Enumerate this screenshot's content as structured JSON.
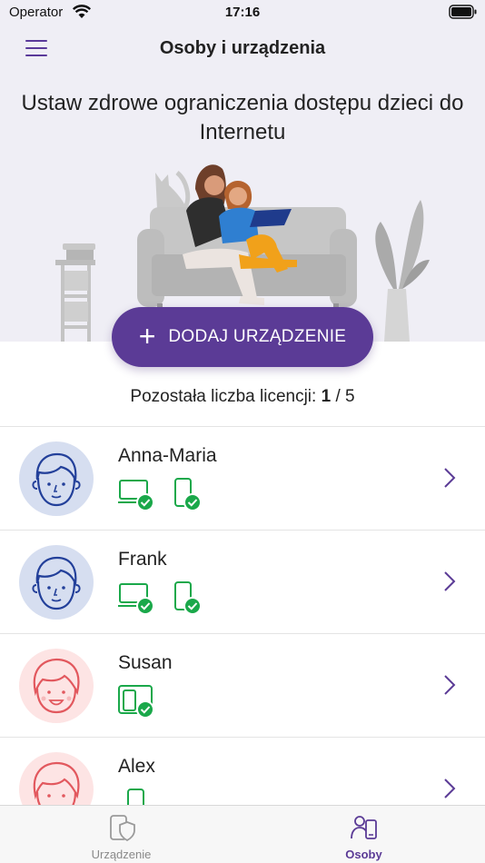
{
  "status_bar": {
    "carrier": "Operator",
    "time": "17:16"
  },
  "header": {
    "title": "Osoby i urządzenia"
  },
  "hero": {
    "headline": "Ustaw zdrowe ograniczenia dostępu dzieci do Internetu"
  },
  "add_device_button": {
    "label": "DODAJ URZĄDZENIE"
  },
  "licenses": {
    "label": "Pozostała liczba licencji:",
    "used": "1",
    "separator": "/",
    "total": "5"
  },
  "people": [
    {
      "name": "Anna-Maria",
      "avatar": "boy-avatar-icon",
      "devices": [
        "laptop-check-icon",
        "phone-check-icon"
      ]
    },
    {
      "name": "Frank",
      "avatar": "boy-avatar-icon",
      "devices": [
        "laptop-check-icon",
        "phone-check-icon"
      ]
    },
    {
      "name": "Susan",
      "avatar": "girl-avatar-icon",
      "devices": [
        "tablet-check-icon"
      ]
    },
    {
      "name": "Alex",
      "avatar": "girl-avatar-icon",
      "devices": [
        "phone-icon"
      ]
    }
  ],
  "tab_bar": {
    "tabs": [
      {
        "label": "Urządzenie",
        "icon": "device-shield-icon",
        "active": false
      },
      {
        "label": "Osoby",
        "icon": "people-devices-icon",
        "active": true
      }
    ]
  },
  "colors": {
    "accent": "#5b3b96",
    "hero_bg": "#efeef5",
    "device_green": "#1aa84a",
    "boy_avatar_bg": "#d6def0",
    "girl_avatar_bg": "#fde4e4"
  }
}
